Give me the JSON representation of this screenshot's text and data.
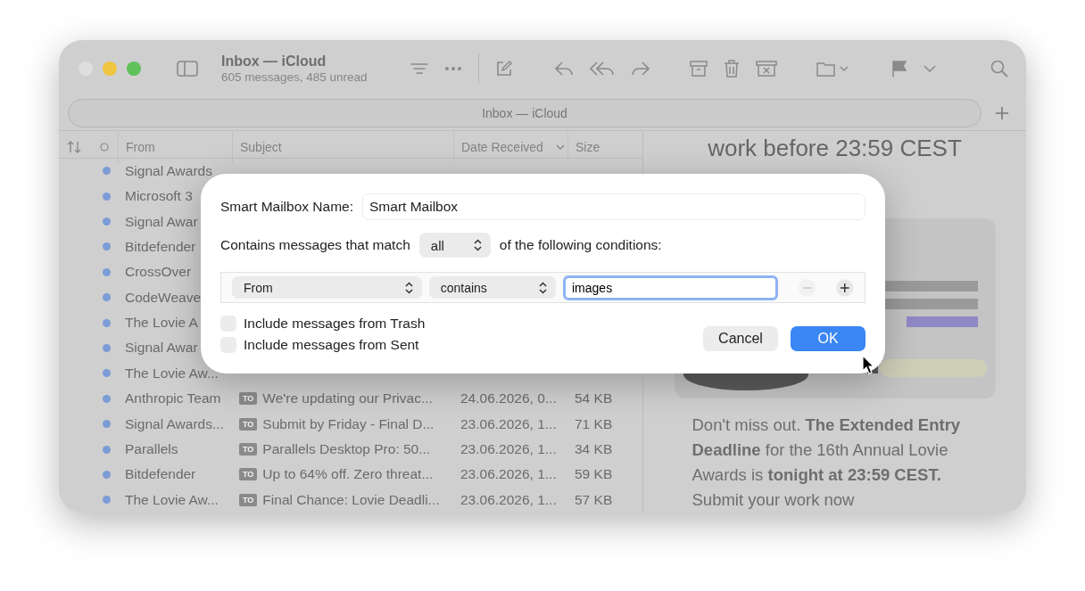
{
  "window": {
    "title": "Inbox — iCloud",
    "subtitle": "605 messages, 485 unread"
  },
  "tab": {
    "label": "Inbox — iCloud"
  },
  "columns": [
    {
      "label": "From",
      "sorted": false
    },
    {
      "label": "Subject",
      "sorted": false
    },
    {
      "label": "Date Received",
      "sorted": true
    },
    {
      "label": "Size",
      "sorted": false
    }
  ],
  "messages": [
    {
      "from": "Signal Awards",
      "unread": true
    },
    {
      "from": "Microsoft 3",
      "unread": true
    },
    {
      "from": "Signal Awar",
      "unread": true
    },
    {
      "from": "Bitdefender",
      "unread": true
    },
    {
      "from": "CrossOver",
      "unread": true
    },
    {
      "from": "CodeWeave",
      "unread": true
    },
    {
      "from": "The Lovie A",
      "unread": true
    },
    {
      "from": "Signal Awar",
      "unread": true
    },
    {
      "from": "The Lovie Aw...",
      "unread": true
    },
    {
      "from": "Anthropic Team",
      "unread": true,
      "tag": "TO",
      "subject": "We're updating our Privac...",
      "date": "24.06.2026, 0...",
      "size": "54 KB"
    },
    {
      "from": "Signal Awards...",
      "unread": true,
      "tag": "TO",
      "subject": "Submit by Friday - Final D...",
      "date": "23.06.2026, 1...",
      "size": "71 KB"
    },
    {
      "from": "Parallels",
      "unread": true,
      "tag": "TO",
      "subject": "Parallels Desktop Pro: 50...",
      "date": "23.06.2026, 1...",
      "size": "34 KB"
    },
    {
      "from": "Bitdefender",
      "unread": true,
      "tag": "TO",
      "subject": "Up to 64% off. Zero threat...",
      "date": "23.06.2026, 1...",
      "size": "59 KB"
    },
    {
      "from": "The Lovie Aw...",
      "unread": true,
      "tag": "TO",
      "subject": "Final Chance: Lovie Deadli...",
      "date": "23.06.2026, 1...",
      "size": "57 KB"
    }
  ],
  "preview": {
    "headline": "work before 23:59 CEST",
    "body": "Don't miss out. **The Extended Entry Deadline** for the 16th Annual Lovie Awards is **tonight at 23:59 CEST.** Submit your work now"
  },
  "dialog": {
    "name_label": "Smart Mailbox Name:",
    "name_value": "Smart Mailbox",
    "match_prefix": "Contains messages that match",
    "match_value": "all",
    "match_suffix": "of the following conditions:",
    "conditions": [
      {
        "field": "From",
        "operator": "contains",
        "value": "images",
        "focused": true,
        "remove_disabled": true
      }
    ],
    "options": [
      {
        "label": "Include messages from Trash",
        "checked": false
      },
      {
        "label": "Include messages from Sent",
        "checked": false
      }
    ],
    "buttons": [
      {
        "label": "Cancel",
        "kind": "secondary"
      },
      {
        "label": "OK",
        "kind": "default"
      }
    ]
  }
}
